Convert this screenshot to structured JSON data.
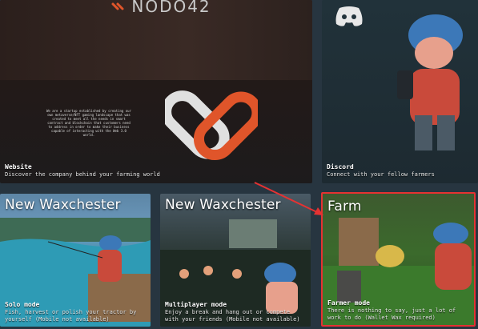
{
  "cards": {
    "website": {
      "logo_text": "NODO42",
      "label": "Website",
      "description": "Discover the company behind your farming world",
      "mission": "We are a startup established by creating our own metaverse/NFT gaming landscape that was created to meet all the needs in smart contract and blockchain that customers need to address in order to make their business capable of interacting with the Web 3.0 world."
    },
    "discord": {
      "label": "Discord",
      "description": "Connect with your fellow farmers"
    },
    "solo": {
      "title": "New Waxchester",
      "label": "Solo mode",
      "description": "Fish, harvest or polish your tractor by yourself (Mobile not available)"
    },
    "multiplayer": {
      "title": "New Waxchester",
      "label": "Multiplayer mode",
      "description": "Enjoy a break and hang out or compete with your friends (Mobile not available)"
    },
    "farm": {
      "title": "Farm",
      "label": "Farmer mode",
      "description": "There is nothing to say, just a lot of work to do (Wallet Wax required)"
    }
  },
  "colors": {
    "highlight_border": "#e53232",
    "arrow": "#e53232",
    "brand_orange": "#e0552a"
  }
}
